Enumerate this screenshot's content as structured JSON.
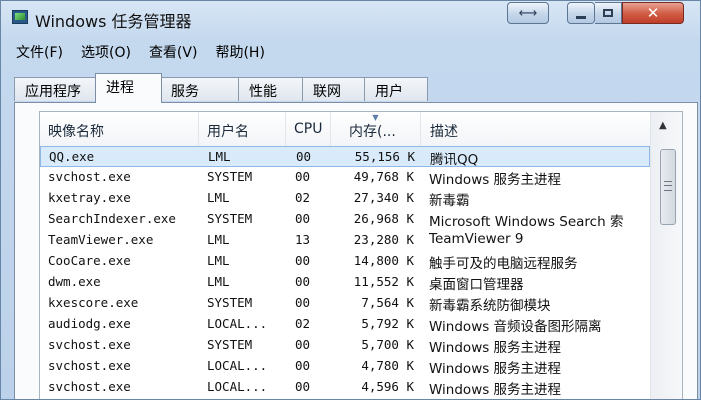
{
  "window": {
    "title": "Windows 任务管理器"
  },
  "menu": [
    "文件(F)",
    "选项(O)",
    "查看(V)",
    "帮助(H)"
  ],
  "tabs": [
    "应用程序",
    "进程",
    "服务",
    "性能",
    "联网",
    "用户"
  ],
  "active_tab": "进程",
  "columns": {
    "image": "映像名称",
    "user": "用户名",
    "cpu": "CPU",
    "mem": "内存(...",
    "desc": "描述"
  },
  "rows": [
    {
      "image": "QQ.exe",
      "user": "LML",
      "cpu": "00",
      "mem": "55,156 K",
      "desc": "腾讯QQ",
      "selected": true
    },
    {
      "image": "svchost.exe",
      "user": "SYSTEM",
      "cpu": "00",
      "mem": "49,768 K",
      "desc": "Windows 服务主进程"
    },
    {
      "image": "kxetray.exe",
      "user": "LML",
      "cpu": "02",
      "mem": "27,340 K",
      "desc": "新毒霸"
    },
    {
      "image": "SearchIndexer.exe",
      "user": "SYSTEM",
      "cpu": "00",
      "mem": "26,968 K",
      "desc": "Microsoft Windows Search 索"
    },
    {
      "image": "TeamViewer.exe",
      "user": "LML",
      "cpu": "13",
      "mem": "23,280 K",
      "desc": "TeamViewer 9"
    },
    {
      "image": "CooCare.exe",
      "user": "LML",
      "cpu": "00",
      "mem": "14,800 K",
      "desc": "触手可及的电脑远程服务"
    },
    {
      "image": "dwm.exe",
      "user": "LML",
      "cpu": "00",
      "mem": "11,552 K",
      "desc": "桌面窗口管理器"
    },
    {
      "image": "kxescore.exe",
      "user": "SYSTEM",
      "cpu": "00",
      "mem": "7,564 K",
      "desc": "新毒霸系统防御模块"
    },
    {
      "image": "audiodg.exe",
      "user": "LOCAL...",
      "cpu": "02",
      "mem": "5,792 K",
      "desc": "Windows 音频设备图形隔离"
    },
    {
      "image": "svchost.exe",
      "user": "SYSTEM",
      "cpu": "00",
      "mem": "5,700 K",
      "desc": "Windows 服务主进程"
    },
    {
      "image": "svchost.exe",
      "user": "LOCAL...",
      "cpu": "00",
      "mem": "4,780 K",
      "desc": "Windows 服务主进程"
    },
    {
      "image": "svchost.exe",
      "user": "LOCAL...",
      "cpu": "00",
      "mem": "4,596 K",
      "desc": "Windows 服务主进程"
    }
  ],
  "colors": {
    "selected_row": "#d9ebfb",
    "close_button": "#d05a43",
    "title_gradient_top": "#d7e6f5"
  }
}
